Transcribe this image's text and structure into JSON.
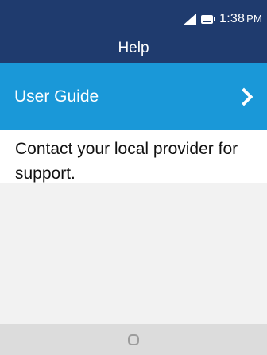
{
  "status_bar": {
    "time": "1:38",
    "ampm": "PM",
    "signal_icon": "signal-icon",
    "battery_icon": "battery-icon"
  },
  "header": {
    "title": "Help"
  },
  "menu": {
    "items": [
      {
        "label": "User Guide",
        "icon": "chevron-right-icon"
      }
    ]
  },
  "message": {
    "text": "Contact your local provider for support."
  },
  "bottom_bar": {
    "center_key_icon": "home-key-icon"
  },
  "colors": {
    "header_bg": "#1f3b6e",
    "selected_item_bg": "#1a98d8",
    "content_bg": "#ffffff",
    "screen_bg": "#f2f2f2",
    "softkey_bar_bg": "#dcdcdc"
  }
}
